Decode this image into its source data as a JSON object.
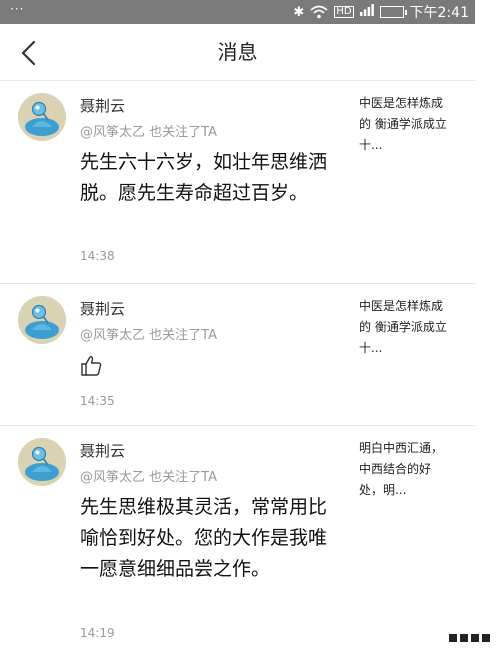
{
  "status_bar": {
    "left_text": "···",
    "network": "HD",
    "time": "下午2:41",
    "icons": [
      "bluetooth-icon",
      "wifi-icon",
      "signal-icon",
      "battery-icon"
    ]
  },
  "header": {
    "title": "消息",
    "back_icon": "chevron-left-icon"
  },
  "messages": [
    {
      "name": "聂荆云",
      "subtitle": "@风筝太乙 也关注了TA",
      "content": "先生六十六岁，如壮年思维洒脱。愿先生寿命超过百岁。",
      "time": "14:38",
      "quote": "中医是怎样炼成的 衡通学派成立十..."
    },
    {
      "name": "聂荆云",
      "subtitle": "@风筝太乙 也关注了TA",
      "content": "",
      "content_icon": "thumbs-up-icon",
      "time": "14:35",
      "quote": "中医是怎样炼成的 衡通学派成立十..."
    },
    {
      "name": "聂荆云",
      "subtitle": "@风筝太乙 也关注了TA",
      "content": "先生思维极其灵活，常常用比喻恰到好处。您的大作是我唯一愿意细细品尝之作。",
      "time": "14:19",
      "quote": "明白中西汇通，中西结合的好处，明..."
    }
  ],
  "colors": {
    "status_bar": "#7a7a7a",
    "background": "#f7f7f7",
    "card": "#ffffff",
    "avatar_bg": "#d9d3b4",
    "avatar_accent": "#3d9fd1",
    "battery": "#6dd36d"
  }
}
